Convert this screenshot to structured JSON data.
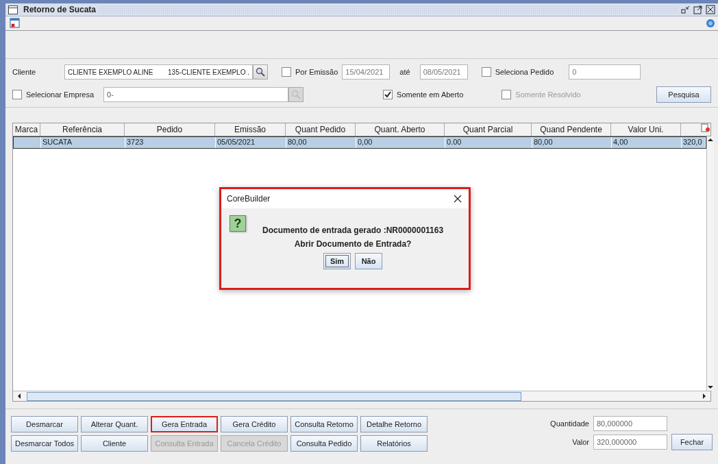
{
  "window": {
    "title": "Retorno de Sucata"
  },
  "filters": {
    "cliente_label": "Cliente",
    "cliente_name": "CLIENTE EXEMPLO ALINE",
    "cliente_code": "135-CLIENTE EXEMPLO .",
    "por_emissao": {
      "label": "Por Emissão",
      "checked": false
    },
    "date_from": "15/04/2021",
    "ate_label": "até",
    "date_to": "08/05/2021",
    "seleciona_pedido": {
      "label": "Seleciona Pedido",
      "checked": false
    },
    "pedido_value": "0",
    "selecionar_empresa": {
      "label": "Selecionar Empresa",
      "checked": false
    },
    "empresa_value": "0-",
    "somente_aberto": {
      "label": "Somente em Aberto",
      "checked": true,
      "disabled": false
    },
    "somente_resolvido": {
      "label": "Somente Resolvido",
      "checked": false,
      "disabled": true
    },
    "search_button": "Pesquisa"
  },
  "table": {
    "columns": [
      "Marca",
      "Referência",
      "Pedido",
      "Emissão",
      "Quant Pedido",
      "Quant. Aberto",
      "Quant Parcial",
      "Quand Pendente",
      "Valor Uni."
    ],
    "rows": [
      {
        "selected": true,
        "cells": [
          "",
          "SUCATA",
          "3723",
          "05/05/2021",
          "80,00",
          "0,00",
          "0.00",
          "80,00",
          "4,00",
          "320,0"
        ]
      }
    ]
  },
  "dialog": {
    "title": "CoreBuilder",
    "icon_glyph": "?",
    "line_1": "Documento de entrada gerado :NR0000001163",
    "line_2": "Abrir Documento de Entrada?",
    "buttons": [
      {
        "label": "Sim",
        "focused": true
      },
      {
        "label": "Não",
        "focused": false
      }
    ],
    "highlighted": true
  },
  "buttons": [
    [
      {
        "label": "Desmarcar",
        "disabled": false,
        "highlighted": false
      },
      {
        "label": "Alterar Quant.",
        "disabled": false,
        "highlighted": false
      },
      {
        "label": "Gera Entrada",
        "disabled": false,
        "highlighted": true
      },
      {
        "label": "Gera Crédito",
        "disabled": false,
        "highlighted": false
      },
      {
        "label": "Consulta Retorno",
        "disabled": false,
        "highlighted": false
      },
      {
        "label": "Detalhe Retorno",
        "disabled": false,
        "highlighted": false
      }
    ],
    [
      {
        "label": "Desmarcar Todos",
        "disabled": false,
        "highlighted": false
      },
      {
        "label": "Cliente",
        "disabled": false,
        "highlighted": false
      },
      {
        "label": "Consulta Entrada",
        "disabled": true,
        "highlighted": false
      },
      {
        "label": "Cancela Crédito",
        "disabled": true,
        "highlighted": false
      },
      {
        "label": "Consulta Pedido",
        "disabled": false,
        "highlighted": false
      },
      {
        "label": "Relatórios",
        "disabled": false,
        "highlighted": false
      }
    ]
  ],
  "totals": {
    "quantidade_label": "Quantidade",
    "quantidade": "80,000000",
    "valor_label": "Valor",
    "valor": "320,000000"
  },
  "close_button": "Fechar"
}
